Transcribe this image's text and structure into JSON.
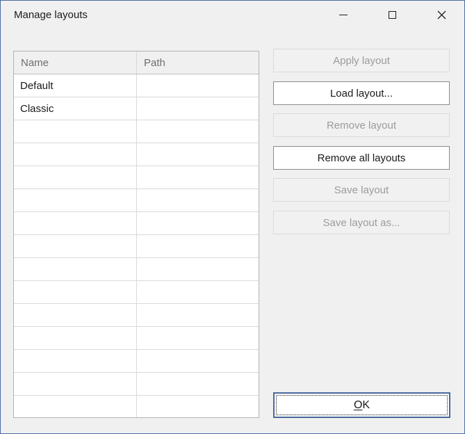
{
  "window": {
    "title": "Manage layouts"
  },
  "icons": {
    "minimize": "minimize-icon",
    "maximize": "maximize-icon",
    "close": "close-icon"
  },
  "table": {
    "columns": [
      "Name",
      "Path"
    ],
    "rows": [
      {
        "name": "Default",
        "path": ""
      },
      {
        "name": "Classic",
        "path": ""
      }
    ],
    "empty_row_count": 13
  },
  "actions": [
    {
      "label": "Apply layout",
      "enabled": false
    },
    {
      "label": "Load layout...",
      "enabled": true
    },
    {
      "label": "Remove layout",
      "enabled": false
    },
    {
      "label": "Remove all layouts",
      "enabled": true
    },
    {
      "label": "Save layout",
      "enabled": false
    },
    {
      "label": "Save layout as...",
      "enabled": false
    }
  ],
  "ok": {
    "accesskey": "O",
    "rest": "K",
    "label": "OK"
  },
  "colors": {
    "window_border": "#4a6da4",
    "dialog_bg": "#f0f0f0",
    "grid_border": "#b2b2b2",
    "grid_line": "#d9d9d9",
    "header_text": "#6e6e6e",
    "disabled_text": "#9b9b9b",
    "enabled_button_border": "#8a8a8a",
    "ok_border": "#48689c"
  }
}
